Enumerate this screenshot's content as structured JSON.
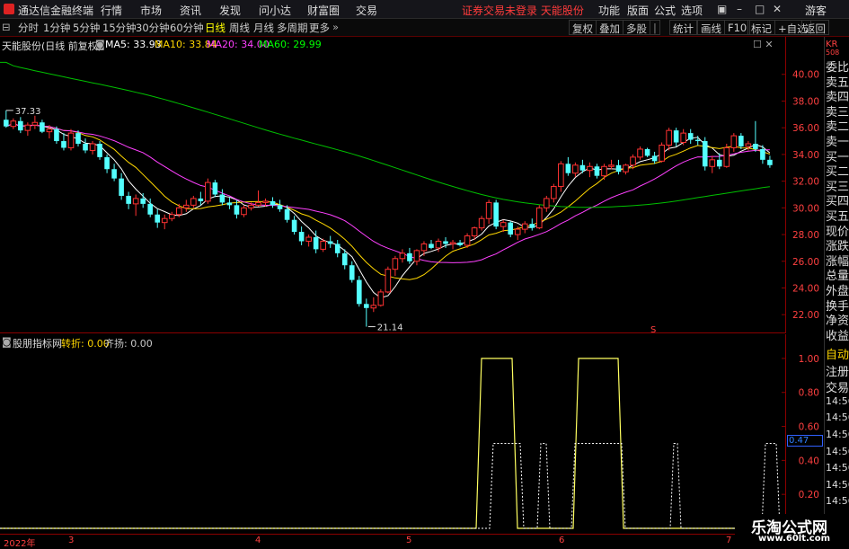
{
  "title_bar": {
    "app_name": "通达信金融终端",
    "menu": [
      "行情",
      "市场",
      "资讯",
      "发现",
      "问小达",
      "财富圈",
      "交易"
    ],
    "notice": "证券交易未登录   天能股份",
    "right_menu": [
      "功能",
      "版面",
      "公式",
      "选项"
    ],
    "user": "游客"
  },
  "toolbar": {
    "periods": [
      "分时",
      "1分钟",
      "5分钟",
      "15分钟",
      "30分钟",
      "60分钟",
      "日线",
      "周线",
      "月线",
      "多周期",
      "更多"
    ],
    "active_period": "日线",
    "right_buttons": [
      "复权",
      "叠加",
      "多股",
      "统计",
      "画线",
      "F10",
      "标记",
      "+自选",
      "返回"
    ]
  },
  "main_chart": {
    "stock_label": "天能股份(日线 前复权)",
    "ma_labels": [
      {
        "text": "MA5: 33.93",
        "color": "#ffffff"
      },
      {
        "text": "MA10: 33.84",
        "color": "#ffd700"
      },
      {
        "text": "MA20: 34.00",
        "color": "#ff40ff"
      },
      {
        "text": "MA60: 29.99",
        "color": "#00ff00"
      }
    ],
    "high_label": "37.33",
    "low_label": "21.14",
    "marker": "S"
  },
  "sub_chart": {
    "name": "股朋指标网",
    "items": [
      {
        "text": "转折: 0.00",
        "color": "#ffd700"
      },
      {
        "text": "齐扬: 0.00",
        "color": "#c8c8c8"
      }
    ],
    "current_value": "0.47"
  },
  "right_panel": {
    "items": [
      "委比",
      "卖五",
      "卖四",
      "卖三",
      "卖二",
      "卖一",
      "买一",
      "买二",
      "买三",
      "买四",
      "买五",
      "现价",
      "涨跌",
      "涨幅",
      "总量",
      "外盘",
      "换手",
      "净资",
      "收益"
    ],
    "sub_items": [
      "自动",
      "注册",
      "交易",
      "14:56",
      "14:56",
      "14:56",
      "14:56",
      "14:56",
      "14:56",
      "14:56",
      "14:56"
    ],
    "header": "KR",
    "header_sub": "508"
  },
  "x_axis": {
    "labels": [
      "2022年",
      "3",
      "4",
      "5",
      "6",
      "7"
    ]
  },
  "watermark": {
    "text": "乐淘公式网",
    "url": "www.60lt.com"
  },
  "chart_data": {
    "type": "candlestick",
    "y_axis_ticks": [
      40.0,
      38.0,
      36.0,
      34.0,
      32.0,
      30.0,
      28.0,
      26.0,
      24.0,
      22.0
    ],
    "ylim": [
      20.6,
      41.8
    ],
    "sub_y_ticks": [
      1.0,
      0.8,
      0.6,
      0.4,
      0.2
    ],
    "sub_ylim": [
      0,
      1.1
    ],
    "candles": [
      [
        36.6,
        37.3,
        36.0,
        36.1
      ],
      [
        36.1,
        36.7,
        35.9,
        36.5
      ],
      [
        36.5,
        36.8,
        35.6,
        35.8
      ],
      [
        35.8,
        36.4,
        35.4,
        36.2
      ],
      [
        36.2,
        36.9,
        35.9,
        36.4
      ],
      [
        36.4,
        36.6,
        35.6,
        35.7
      ],
      [
        35.7,
        36.2,
        35.2,
        35.9
      ],
      [
        35.9,
        36.1,
        34.8,
        35.0
      ],
      [
        35.0,
        35.6,
        34.3,
        34.5
      ],
      [
        34.5,
        35.9,
        34.3,
        35.6
      ],
      [
        35.6,
        35.8,
        34.6,
        34.8
      ],
      [
        34.8,
        35.2,
        34.1,
        34.3
      ],
      [
        34.3,
        35.0,
        34.0,
        34.8
      ],
      [
        34.8,
        35.0,
        33.6,
        33.8
      ],
      [
        33.8,
        34.0,
        32.6,
        32.9
      ],
      [
        32.9,
        33.3,
        32.0,
        32.2
      ],
      [
        32.2,
        32.6,
        30.6,
        30.9
      ],
      [
        30.9,
        31.2,
        29.9,
        30.3
      ],
      [
        30.3,
        31.0,
        29.4,
        30.7
      ],
      [
        30.7,
        31.1,
        30.0,
        30.3
      ],
      [
        30.3,
        30.7,
        29.3,
        29.5
      ],
      [
        29.5,
        29.9,
        28.5,
        28.9
      ],
      [
        28.9,
        29.5,
        28.4,
        29.2
      ],
      [
        29.2,
        29.7,
        29.0,
        29.5
      ],
      [
        29.5,
        30.3,
        29.3,
        30.0
      ],
      [
        30.0,
        30.6,
        29.7,
        30.2
      ],
      [
        30.2,
        30.9,
        30.0,
        30.7
      ],
      [
        30.7,
        31.2,
        30.2,
        30.5
      ],
      [
        30.5,
        32.2,
        30.3,
        31.9
      ],
      [
        31.9,
        32.1,
        30.8,
        31.0
      ],
      [
        31.0,
        31.4,
        30.2,
        30.4
      ],
      [
        30.4,
        30.8,
        29.9,
        30.2
      ],
      [
        30.2,
        30.6,
        29.2,
        29.5
      ],
      [
        29.5,
        30.2,
        29.3,
        30.0
      ],
      [
        30.0,
        30.4,
        29.8,
        30.2
      ],
      [
        30.2,
        31.3,
        30.1,
        30.4
      ],
      [
        30.4,
        30.7,
        30.1,
        30.5
      ],
      [
        30.5,
        30.8,
        30.0,
        30.2
      ],
      [
        30.2,
        30.6,
        29.7,
        29.9
      ],
      [
        29.9,
        30.2,
        28.9,
        29.1
      ],
      [
        29.1,
        29.4,
        28.0,
        28.2
      ],
      [
        28.2,
        28.6,
        27.2,
        27.5
      ],
      [
        27.5,
        28.0,
        27.1,
        27.8
      ],
      [
        27.8,
        28.3,
        26.6,
        26.9
      ],
      [
        26.9,
        27.7,
        26.7,
        27.5
      ],
      [
        27.5,
        27.9,
        27.0,
        27.3
      ],
      [
        27.3,
        27.6,
        26.3,
        26.6
      ],
      [
        26.6,
        26.9,
        25.4,
        25.7
      ],
      [
        25.7,
        26.0,
        24.4,
        24.6
      ],
      [
        24.6,
        24.9,
        22.6,
        22.8
      ],
      [
        22.8,
        23.2,
        21.1,
        22.5
      ],
      [
        22.5,
        23.3,
        22.2,
        22.7
      ],
      [
        22.7,
        23.9,
        22.6,
        23.7
      ],
      [
        23.7,
        25.6,
        23.6,
        25.4
      ],
      [
        25.4,
        26.4,
        24.9,
        26.2
      ],
      [
        26.2,
        26.9,
        25.9,
        26.6
      ],
      [
        26.6,
        27.0,
        25.8,
        26.0
      ],
      [
        26.0,
        26.9,
        25.7,
        26.8
      ],
      [
        26.8,
        27.5,
        26.4,
        27.3
      ],
      [
        27.3,
        27.6,
        26.9,
        27.0
      ],
      [
        27.0,
        27.7,
        26.7,
        27.5
      ],
      [
        27.5,
        27.8,
        27.0,
        27.3
      ],
      [
        27.3,
        27.6,
        26.9,
        27.4
      ],
      [
        27.4,
        27.6,
        27.1,
        27.2
      ],
      [
        27.2,
        28.1,
        27.0,
        27.9
      ],
      [
        27.9,
        28.6,
        27.6,
        28.5
      ],
      [
        28.5,
        29.4,
        28.3,
        29.2
      ],
      [
        29.2,
        30.6,
        28.8,
        30.4
      ],
      [
        30.4,
        30.6,
        28.4,
        28.6
      ],
      [
        28.6,
        29.1,
        28.2,
        28.9
      ],
      [
        28.9,
        29.0,
        27.8,
        28.0
      ],
      [
        28.0,
        28.6,
        27.6,
        28.4
      ],
      [
        28.4,
        29.0,
        28.1,
        28.8
      ],
      [
        28.8,
        29.2,
        28.3,
        28.5
      ],
      [
        28.5,
        30.2,
        28.4,
        30.0
      ],
      [
        30.0,
        30.9,
        29.7,
        30.7
      ],
      [
        30.7,
        31.8,
        30.4,
        31.6
      ],
      [
        31.6,
        33.5,
        31.2,
        33.3
      ],
      [
        33.3,
        33.8,
        32.4,
        32.6
      ],
      [
        32.6,
        33.4,
        32.3,
        33.2
      ],
      [
        33.2,
        33.6,
        32.6,
        32.8
      ],
      [
        32.8,
        33.4,
        32.3,
        33.1
      ],
      [
        33.1,
        33.3,
        32.2,
        32.4
      ],
      [
        32.4,
        33.3,
        32.1,
        33.1
      ],
      [
        33.1,
        33.6,
        32.9,
        33.2
      ],
      [
        33.2,
        33.6,
        32.5,
        32.7
      ],
      [
        32.7,
        33.3,
        32.5,
        33.2
      ],
      [
        33.2,
        34.0,
        32.9,
        33.8
      ],
      [
        33.8,
        34.6,
        33.6,
        34.4
      ],
      [
        34.4,
        34.5,
        33.8,
        33.9
      ],
      [
        33.9,
        34.2,
        33.3,
        33.5
      ],
      [
        33.5,
        34.9,
        33.4,
        34.7
      ],
      [
        34.7,
        36.0,
        34.3,
        35.8
      ],
      [
        35.8,
        36.0,
        34.6,
        34.9
      ],
      [
        34.9,
        35.9,
        34.7,
        35.6
      ],
      [
        35.6,
        35.9,
        34.8,
        35.1
      ],
      [
        35.1,
        35.4,
        34.7,
        35.0
      ],
      [
        35.0,
        35.3,
        32.8,
        33.1
      ],
      [
        33.1,
        33.9,
        32.6,
        33.6
      ],
      [
        33.6,
        34.1,
        32.9,
        33.1
      ],
      [
        33.1,
        34.8,
        33.0,
        34.5
      ],
      [
        34.5,
        35.6,
        34.2,
        35.4
      ],
      [
        35.4,
        35.6,
        34.4,
        34.6
      ],
      [
        34.6,
        35.0,
        34.3,
        34.8
      ],
      [
        34.8,
        36.5,
        34.2,
        34.4
      ],
      [
        34.4,
        34.7,
        33.3,
        33.6
      ],
      [
        33.6,
        33.9,
        33.0,
        33.2
      ]
    ],
    "ma60_start": 40.9,
    "signal_solid": [
      {
        "from": 0.0,
        "to": 0.0
      },
      {
        "pulse": [
          530,
          576
        ],
        "level": 1.0
      },
      {
        "pulse": [
          638,
          694
        ],
        "level": 1.0
      }
    ],
    "signal_dashed": [
      {
        "pulse": [
          545,
          583
        ],
        "level": 0.5
      },
      {
        "pulse": [
          598,
          612
        ],
        "level": 0.5
      },
      {
        "pulse": [
          636,
          696
        ],
        "level": 0.5
      },
      {
        "pulse": [
          746,
          758
        ],
        "level": 0.5
      },
      {
        "pulse": [
          848,
          868
        ],
        "level": 0.5
      }
    ]
  }
}
